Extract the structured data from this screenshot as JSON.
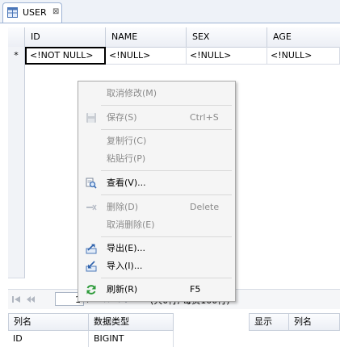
{
  "tab": {
    "title": "USER",
    "close_glyph": "⊠"
  },
  "grid": {
    "columns": [
      "ID",
      "NAME",
      "SEX",
      "AGE"
    ],
    "new_row_marker": "*",
    "new_row": [
      "<!NOT NULL>",
      "<!NULL>",
      "<!NULL>",
      "<!NULL>"
    ]
  },
  "context_menu": {
    "items": [
      {
        "label": "取消修改(M)",
        "shortcut": "",
        "enabled": false,
        "icon": ""
      },
      {
        "label": "保存(S)",
        "shortcut": "Ctrl+S",
        "enabled": false,
        "icon": "save-icon"
      },
      {
        "label": "复制行(C)",
        "shortcut": "",
        "enabled": false,
        "icon": ""
      },
      {
        "label": "粘贴行(P)",
        "shortcut": "",
        "enabled": false,
        "icon": ""
      },
      {
        "label": "查看(V)...",
        "shortcut": "",
        "enabled": true,
        "icon": "view-icon"
      },
      {
        "label": "删除(D)",
        "shortcut": "Delete",
        "enabled": false,
        "icon": "delete-row-icon"
      },
      {
        "label": "取消删除(E)",
        "shortcut": "",
        "enabled": false,
        "icon": ""
      },
      {
        "label": "导出(E)...",
        "shortcut": "",
        "enabled": true,
        "icon": "export-icon"
      },
      {
        "label": "导入(I)...",
        "shortcut": "",
        "enabled": true,
        "icon": "import-icon"
      },
      {
        "label": "刷新(R)",
        "shortcut": "F5",
        "enabled": true,
        "icon": "refresh-icon"
      }
    ]
  },
  "navbar": {
    "page": "1",
    "page_total": "/1",
    "summary": "(共0行, 每页100行)"
  },
  "bottom_left": {
    "columns": [
      "列名",
      "数据类型"
    ],
    "rows": [
      [
        "ID",
        "BIGINT"
      ]
    ]
  },
  "bottom_right": {
    "columns": [
      "显示",
      "列名"
    ]
  },
  "colors": {
    "accent": "#9db3d4",
    "menu_bg": "#f5f5f5",
    "disabled_text": "#8a8a8a"
  }
}
